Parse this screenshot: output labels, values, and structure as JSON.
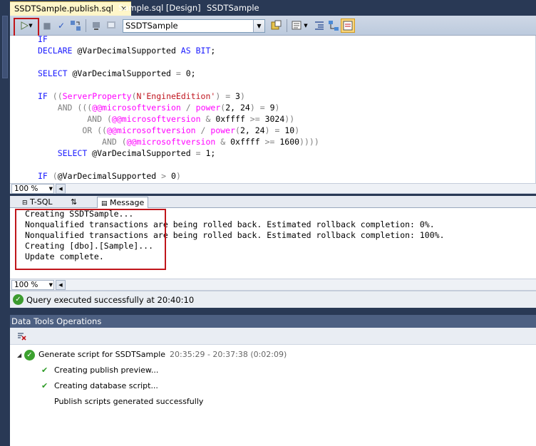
{
  "tabs": [
    {
      "label": "SSDTSample.publish.sql",
      "active": true
    },
    {
      "label": "Sample.sql [Design]",
      "active": false
    },
    {
      "label": "SSDTSample",
      "active": false
    }
  ],
  "toolbar": {
    "database": "SSDTSample",
    "execute_icon": "execute-play-icon"
  },
  "editor": {
    "zoom": "100 %"
  },
  "results": {
    "zoom": "100 %",
    "tabs": [
      {
        "label": "T-SQL"
      },
      {
        "label": "Message"
      }
    ],
    "messages": [
      "Creating SSDTSample...",
      "Nonqualified transactions are being rolled back. Estimated rollback completion: 0%.",
      "Nonqualified transactions are being rolled back. Estimated rollback completion: 100%.",
      "Creating [dbo].[Sample]...",
      "Update complete."
    ]
  },
  "status": {
    "text": "Query executed successfully at 20:40:10"
  },
  "operations": {
    "title": "Data Tools Operations",
    "root": {
      "label": "Generate script for SSDTSample",
      "time": "20:35:29 - 20:37:38 (0:02:09)"
    },
    "children": [
      {
        "label": "Creating publish preview...",
        "status": "success"
      },
      {
        "label": "Creating database script...",
        "status": "success"
      },
      {
        "label": "Publish scripts generated successfully",
        "status": "info"
      }
    ]
  },
  "colors": {
    "keyword": "#1a1aff",
    "function": "#ff00ff",
    "string": "#c0151f",
    "operator": "#808080",
    "highlight": "#c0161b"
  }
}
